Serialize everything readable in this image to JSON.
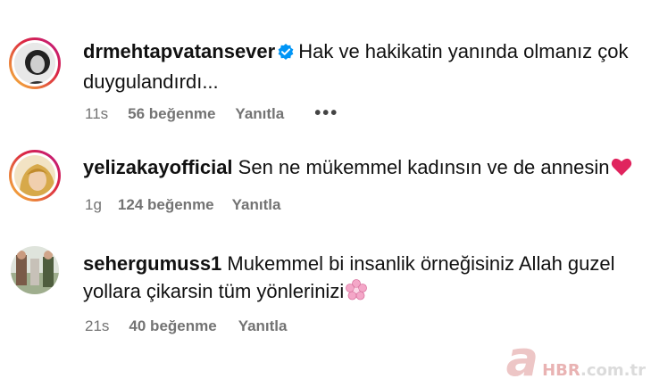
{
  "comments": [
    {
      "username": "drmehtapvatansever",
      "verified": true,
      "text_line1": "Hak ve hakikatin yanında olmanız çok",
      "text_line2": "duygulandırdı...",
      "time": "11s",
      "likes": "56 beğenme",
      "reply": "Yanıtla",
      "more": "•••"
    },
    {
      "username": "yelizakayofficial",
      "verified": false,
      "text_line1": "Sen ne mükemmel kadınsın ve de annesin",
      "emoji": "red-heart-icon",
      "time": "1g",
      "likes": "124 beğenme",
      "reply": "Yanıtla"
    },
    {
      "username": "sehergumuss1",
      "verified": false,
      "text_line1": "Mukemmel bi insanlik örneğisiniz Allah guzel",
      "text_line2": "yollara çikarsin tüm yönlerinizi",
      "emoji": "cherry-blossom-icon",
      "time": "21s",
      "likes": "40 beğenme",
      "reply": "Yanıtla"
    }
  ],
  "watermark": {
    "letter": "a",
    "brand": "HBR",
    "domain": ".com.tr"
  },
  "colors": {
    "meta": "#737373",
    "verified": "#0095f6",
    "heart": "#e0245e"
  }
}
